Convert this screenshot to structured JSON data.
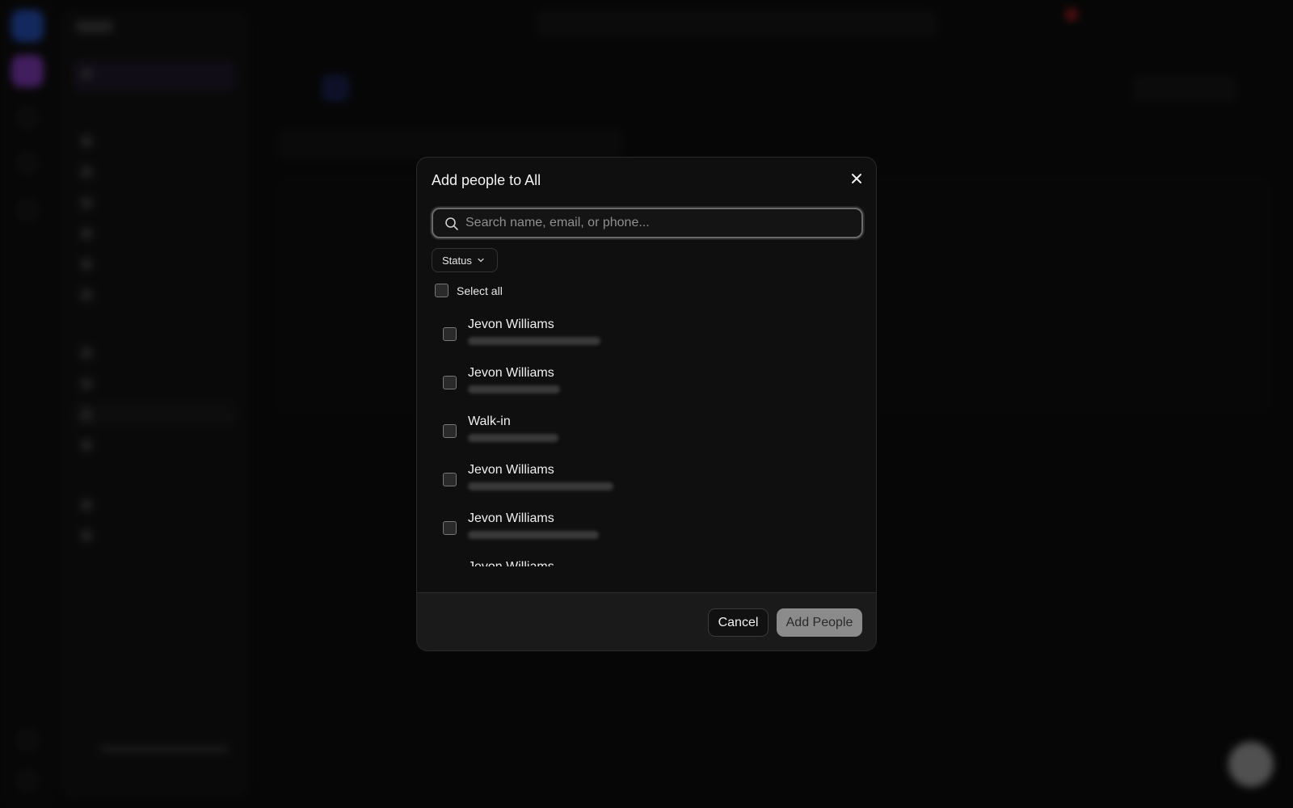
{
  "modal": {
    "title": "Add people to All",
    "search_placeholder": "Search name, email, or phone...",
    "status_filter_label": "Status",
    "select_all_label": "Select all",
    "people": [
      {
        "name": "Jevon Williams"
      },
      {
        "name": "Jevon Williams"
      },
      {
        "name": "Walk-in"
      },
      {
        "name": "Jevon Williams"
      },
      {
        "name": "Jevon Williams"
      },
      {
        "name": "Jevon Williams"
      }
    ],
    "cancel_label": "Cancel",
    "add_label": "Add People"
  },
  "colors": {
    "background": "#0a0a0a",
    "modal_bg": "#0f0f0f",
    "footer_bg": "#1a1a1a",
    "primary_button_disabled": "#8b8b8b",
    "accent_blue": "#2f6bff",
    "accent_purple": "#b04cff",
    "notification_red": "#e0242a"
  },
  "icons": {
    "close": "close-icon",
    "search": "search-icon",
    "dropdown": "chevron-down-icon"
  }
}
